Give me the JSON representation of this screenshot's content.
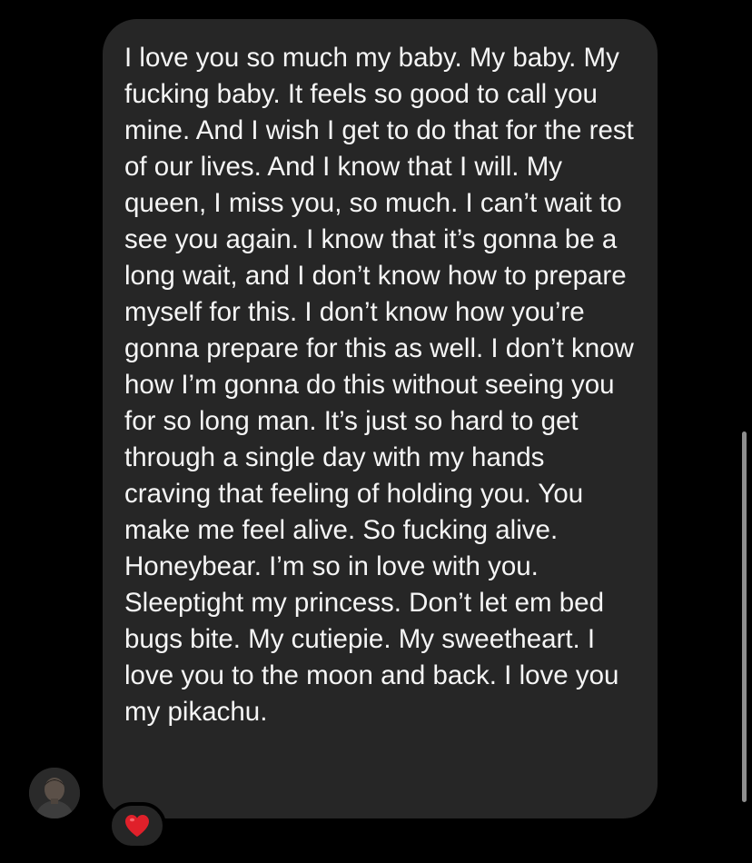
{
  "message": {
    "text": "I love you so much my baby. My baby. My fucking baby. It feels so good to call you mine. And I wish I get to do that for the rest of our lives. And I know that I will. My queen, I miss you, so much. I can’t wait to see you again. I know that it’s gonna be a long wait, and I don’t know how to prepare myself for this. I don’t know how you’re gonna prepare for this as well. I don’t know how I’m gonna do this without seeing you for so long man. It’s just so hard to get through a single day with my hands craving that feeling of holding you. You make me feel alive. So fucking alive. Honeybear. I’m so in love with you. Sleeptight my princess. Don’t let em bed bugs bite. My cutiepie. My sweetheart. I love you to the moon and back. I love you my pikachu.",
    "bubble_color": "#262626",
    "text_color": "#f5f5f5"
  },
  "reaction": {
    "icon": "red-heart-icon",
    "color": "#e0202a"
  },
  "sender": {
    "avatar_icon": "profile-photo"
  },
  "background_color": "#000000"
}
